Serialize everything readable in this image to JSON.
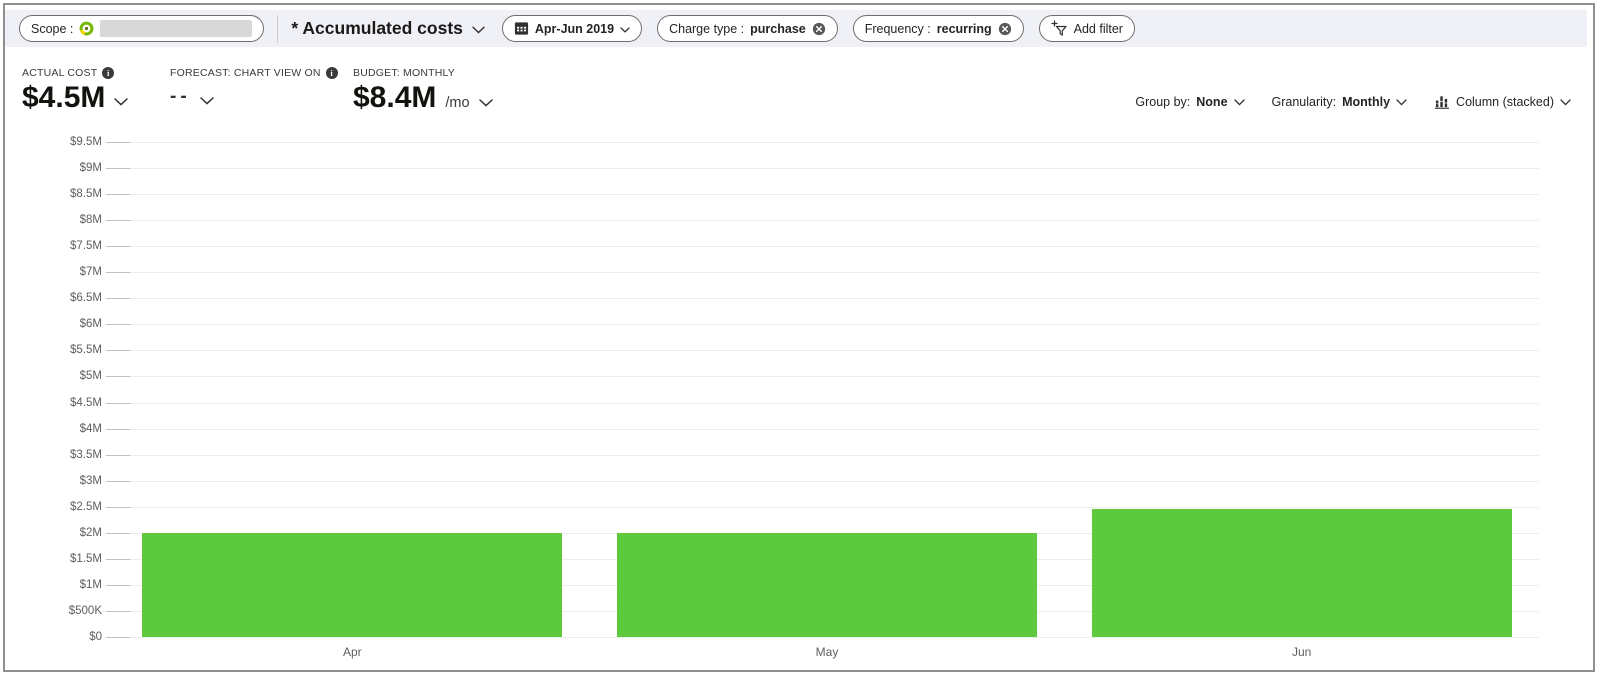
{
  "toolbar": {
    "scope_label": "Scope :",
    "view_title": "* Accumulated costs",
    "date_range": "Apr-Jun 2019",
    "filters": [
      {
        "label": "Charge type :",
        "value": "purchase"
      },
      {
        "label": "Frequency :",
        "value": "recurring"
      }
    ],
    "add_filter_label": "Add filter"
  },
  "kpis": {
    "actual_cost_label": "ACTUAL COST",
    "actual_cost_value": "$4.5M",
    "forecast_label": "FORECAST: CHART VIEW ON",
    "forecast_value": "--",
    "budget_label": "BUDGET: MONTHLY",
    "budget_value": "$8.4M",
    "budget_suffix": "/mo"
  },
  "controls": {
    "group_by_label": "Group by:",
    "group_by_value": "None",
    "granularity_label": "Granularity:",
    "granularity_value": "Monthly",
    "chart_type_label": "Column (stacked)"
  },
  "chart_data": {
    "type": "bar",
    "title": "Accumulated costs",
    "categories": [
      "Apr",
      "May",
      "Jun"
    ],
    "values": [
      2.0,
      2.0,
      2.45
    ],
    "unit": "USD millions",
    "ylim": [
      0,
      9.5
    ],
    "ytick_step": 0.5,
    "ytick_order": "top-to-bottom",
    "ytick_labels": [
      "$9.5M",
      "$9M",
      "$8.5M",
      "$8M",
      "$7.5M",
      "$7M",
      "$6.5M",
      "$6M",
      "$5.5M",
      "$5M",
      "$4.5M",
      "$4M",
      "$3.5M",
      "$3M",
      "$2.5M",
      "$2M",
      "$1.5M",
      "$1M",
      "$500K",
      "$0"
    ],
    "grid": true,
    "legend": "none",
    "bar_color": "#5dc93d"
  },
  "colors": {
    "toolbar_bg": "#f0f1f6",
    "bar_green": "#5dc93d",
    "subscription_green": "#76b900",
    "subscription_yellow": "#ffd400"
  }
}
